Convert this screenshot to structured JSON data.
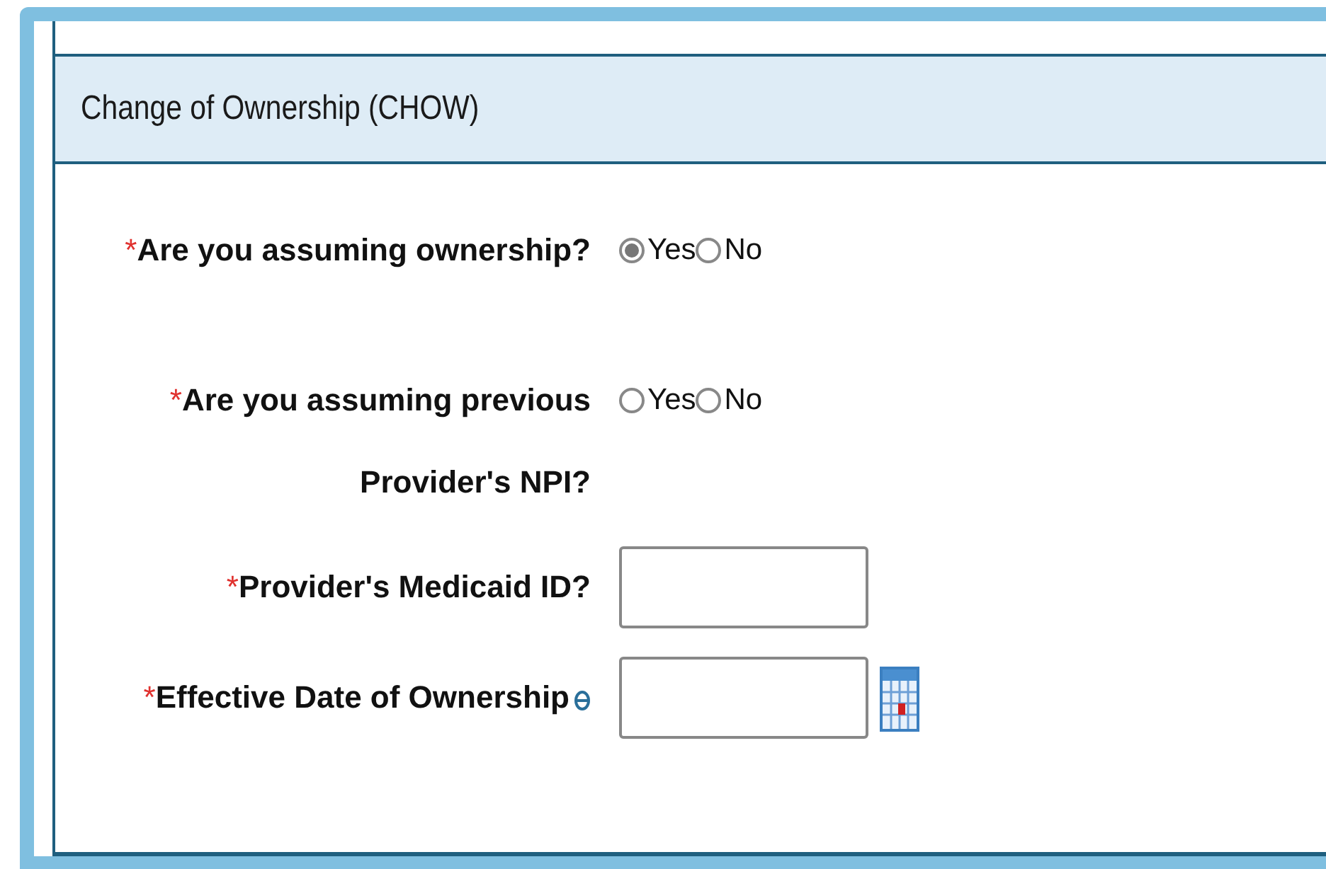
{
  "section": {
    "title": "Change of Ownership (CHOW)"
  },
  "fields": [
    {
      "kind": "radio",
      "required_mark": "*",
      "label": "Are you assuming ownership?",
      "options": [
        {
          "label": "Yes",
          "selected": true
        },
        {
          "label": "No",
          "selected": false
        }
      ]
    },
    {
      "kind": "radio",
      "required_mark": "*",
      "label": "Are you assuming previous Provider's NPI?",
      "options": [
        {
          "label": "Yes",
          "selected": false
        },
        {
          "label": "No",
          "selected": false
        }
      ]
    },
    {
      "kind": "text",
      "required_mark": "*",
      "label": "Provider's Medicaid ID?"
    },
    {
      "kind": "date",
      "required_mark": "*",
      "label": "Effective Date of Ownership",
      "info": true
    }
  ]
}
